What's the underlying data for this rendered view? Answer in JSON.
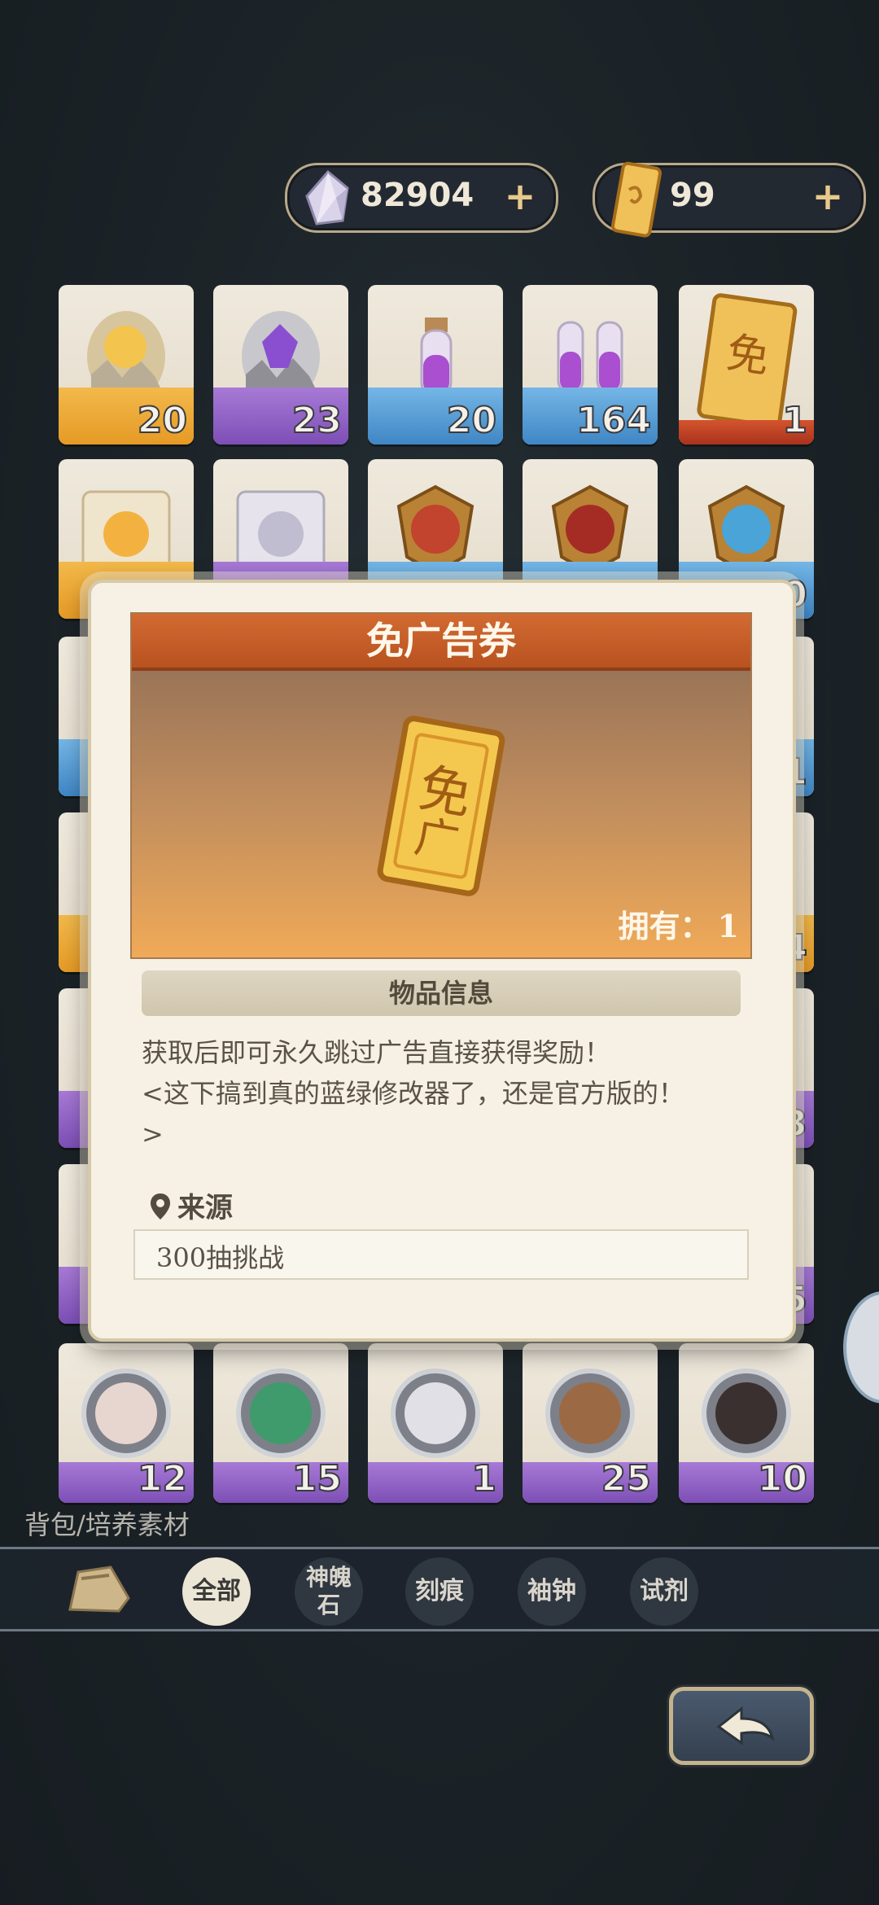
{
  "currencies": [
    {
      "name": "crystal",
      "value": "82904",
      "plus": "+"
    },
    {
      "name": "ad-free-ticket",
      "value": "99",
      "plus": "+"
    }
  ],
  "grid_rows": [
    [
      {
        "rarity": "gold",
        "icon": "gold-egg-icon",
        "count": "20"
      },
      {
        "rarity": "purple",
        "icon": "purple-egg-icon",
        "count": "23"
      },
      {
        "rarity": "blue",
        "icon": "potion-icon",
        "count": "20"
      },
      {
        "rarity": "blue",
        "icon": "double-potion-icon",
        "count": "164"
      },
      {
        "rarity": "red",
        "icon": "ad-free-ticket-icon",
        "count": "1"
      }
    ],
    [
      {
        "rarity": "gold",
        "icon": "gold-scroll-icon",
        "count": ""
      },
      {
        "rarity": "purple",
        "icon": "silver-scroll-icon",
        "count": ""
      },
      {
        "rarity": "blue",
        "icon": "red-emblem-icon",
        "count": ""
      },
      {
        "rarity": "blue",
        "icon": "dragon-emblem-icon",
        "count": ""
      },
      {
        "rarity": "blue",
        "icon": "blue-emblem-icon",
        "count": "0"
      }
    ],
    [
      {
        "rarity": "blue",
        "icon": "item-icon",
        "count": ""
      },
      {
        "rarity": "blue",
        "icon": "item-icon",
        "count": "1"
      }
    ],
    [
      {
        "rarity": "gold",
        "icon": "item-icon",
        "count": ""
      },
      {
        "rarity": "gold",
        "icon": "item-icon",
        "count": "4"
      }
    ],
    [
      {
        "rarity": "purple",
        "icon": "item-icon",
        "count": ""
      },
      {
        "rarity": "purple",
        "icon": "item-icon",
        "count": "3"
      }
    ],
    [
      {
        "rarity": "purple",
        "icon": "item-icon",
        "count": ""
      },
      {
        "rarity": "purple",
        "icon": "item-icon",
        "count": "5"
      }
    ],
    [
      {
        "rarity": "purple",
        "icon": "portrait-icon",
        "count": "12"
      },
      {
        "rarity": "purple",
        "icon": "portrait-icon",
        "count": "15"
      },
      {
        "rarity": "purple",
        "icon": "portrait-icon",
        "count": "1"
      },
      {
        "rarity": "purple",
        "icon": "portrait-icon",
        "count": "25"
      },
      {
        "rarity": "purple",
        "icon": "portrait-icon",
        "count": "10"
      }
    ]
  ],
  "modal": {
    "title": "免广告券",
    "owned_label": "拥有：",
    "owned_value": "1",
    "info_header": "物品信息",
    "description_line1": "获取后即可永久跳过广告直接获得奖励！",
    "description_line2": "<这下搞到真的蓝绿修改器了，还是官方版的！",
    "description_line3": ">",
    "source_label": "来源",
    "source_value": "300抽挑战"
  },
  "section_label": "背包/培养素材",
  "tabs": [
    {
      "label": "全部",
      "active": true
    },
    {
      "label": "神魄石",
      "active": false
    },
    {
      "label": "刻痕",
      "active": false
    },
    {
      "label": "袖钟",
      "active": false
    },
    {
      "label": "试剂",
      "active": false
    }
  ],
  "colors": {
    "accent": "#b8521f",
    "modal_bg": "#f6f1e4",
    "gold": "#e69a25",
    "purple": "#7d4fb6",
    "blue": "#3f86c4",
    "red": "#a9321c"
  }
}
